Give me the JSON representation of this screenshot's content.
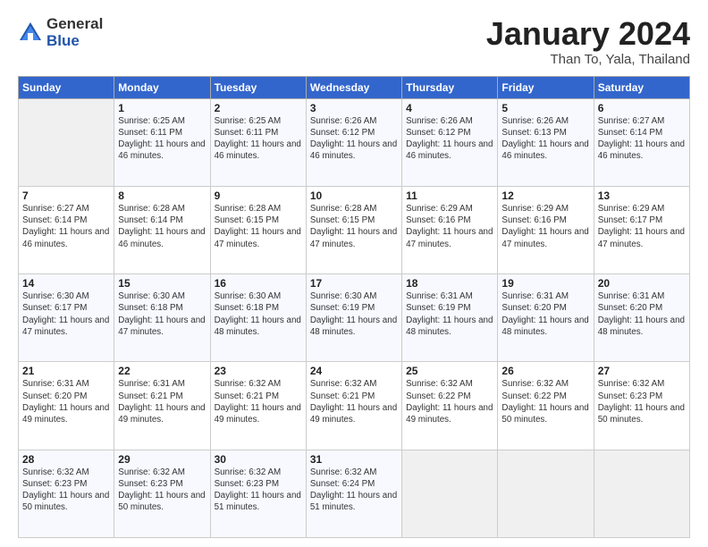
{
  "header": {
    "logo": {
      "general": "General",
      "blue": "Blue"
    },
    "title": "January 2024",
    "location": "Than To, Yala, Thailand"
  },
  "calendar": {
    "days_of_week": [
      "Sunday",
      "Monday",
      "Tuesday",
      "Wednesday",
      "Thursday",
      "Friday",
      "Saturday"
    ],
    "weeks": [
      [
        {
          "day": "",
          "empty": true
        },
        {
          "day": "1",
          "sunrise": "6:25 AM",
          "sunset": "6:11 PM",
          "daylight": "11 hours and 46 minutes."
        },
        {
          "day": "2",
          "sunrise": "6:25 AM",
          "sunset": "6:11 PM",
          "daylight": "11 hours and 46 minutes."
        },
        {
          "day": "3",
          "sunrise": "6:26 AM",
          "sunset": "6:12 PM",
          "daylight": "11 hours and 46 minutes."
        },
        {
          "day": "4",
          "sunrise": "6:26 AM",
          "sunset": "6:12 PM",
          "daylight": "11 hours and 46 minutes."
        },
        {
          "day": "5",
          "sunrise": "6:26 AM",
          "sunset": "6:13 PM",
          "daylight": "11 hours and 46 minutes."
        },
        {
          "day": "6",
          "sunrise": "6:27 AM",
          "sunset": "6:14 PM",
          "daylight": "11 hours and 46 minutes."
        }
      ],
      [
        {
          "day": "7",
          "sunrise": "6:27 AM",
          "sunset": "6:14 PM",
          "daylight": "11 hours and 46 minutes."
        },
        {
          "day": "8",
          "sunrise": "6:28 AM",
          "sunset": "6:14 PM",
          "daylight": "11 hours and 46 minutes."
        },
        {
          "day": "9",
          "sunrise": "6:28 AM",
          "sunset": "6:15 PM",
          "daylight": "11 hours and 47 minutes."
        },
        {
          "day": "10",
          "sunrise": "6:28 AM",
          "sunset": "6:15 PM",
          "daylight": "11 hours and 47 minutes."
        },
        {
          "day": "11",
          "sunrise": "6:29 AM",
          "sunset": "6:16 PM",
          "daylight": "11 hours and 47 minutes."
        },
        {
          "day": "12",
          "sunrise": "6:29 AM",
          "sunset": "6:16 PM",
          "daylight": "11 hours and 47 minutes."
        },
        {
          "day": "13",
          "sunrise": "6:29 AM",
          "sunset": "6:17 PM",
          "daylight": "11 hours and 47 minutes."
        }
      ],
      [
        {
          "day": "14",
          "sunrise": "6:30 AM",
          "sunset": "6:17 PM",
          "daylight": "11 hours and 47 minutes."
        },
        {
          "day": "15",
          "sunrise": "6:30 AM",
          "sunset": "6:18 PM",
          "daylight": "11 hours and 47 minutes."
        },
        {
          "day": "16",
          "sunrise": "6:30 AM",
          "sunset": "6:18 PM",
          "daylight": "11 hours and 48 minutes."
        },
        {
          "day": "17",
          "sunrise": "6:30 AM",
          "sunset": "6:19 PM",
          "daylight": "11 hours and 48 minutes."
        },
        {
          "day": "18",
          "sunrise": "6:31 AM",
          "sunset": "6:19 PM",
          "daylight": "11 hours and 48 minutes."
        },
        {
          "day": "19",
          "sunrise": "6:31 AM",
          "sunset": "6:20 PM",
          "daylight": "11 hours and 48 minutes."
        },
        {
          "day": "20",
          "sunrise": "6:31 AM",
          "sunset": "6:20 PM",
          "daylight": "11 hours and 48 minutes."
        }
      ],
      [
        {
          "day": "21",
          "sunrise": "6:31 AM",
          "sunset": "6:20 PM",
          "daylight": "11 hours and 49 minutes."
        },
        {
          "day": "22",
          "sunrise": "6:31 AM",
          "sunset": "6:21 PM",
          "daylight": "11 hours and 49 minutes."
        },
        {
          "day": "23",
          "sunrise": "6:32 AM",
          "sunset": "6:21 PM",
          "daylight": "11 hours and 49 minutes."
        },
        {
          "day": "24",
          "sunrise": "6:32 AM",
          "sunset": "6:21 PM",
          "daylight": "11 hours and 49 minutes."
        },
        {
          "day": "25",
          "sunrise": "6:32 AM",
          "sunset": "6:22 PM",
          "daylight": "11 hours and 49 minutes."
        },
        {
          "day": "26",
          "sunrise": "6:32 AM",
          "sunset": "6:22 PM",
          "daylight": "11 hours and 50 minutes."
        },
        {
          "day": "27",
          "sunrise": "6:32 AM",
          "sunset": "6:23 PM",
          "daylight": "11 hours and 50 minutes."
        }
      ],
      [
        {
          "day": "28",
          "sunrise": "6:32 AM",
          "sunset": "6:23 PM",
          "daylight": "11 hours and 50 minutes."
        },
        {
          "day": "29",
          "sunrise": "6:32 AM",
          "sunset": "6:23 PM",
          "daylight": "11 hours and 50 minutes."
        },
        {
          "day": "30",
          "sunrise": "6:32 AM",
          "sunset": "6:23 PM",
          "daylight": "11 hours and 51 minutes."
        },
        {
          "day": "31",
          "sunrise": "6:32 AM",
          "sunset": "6:24 PM",
          "daylight": "11 hours and 51 minutes."
        },
        {
          "day": "",
          "empty": true
        },
        {
          "day": "",
          "empty": true
        },
        {
          "day": "",
          "empty": true
        }
      ]
    ]
  },
  "labels": {
    "sunrise": "Sunrise:",
    "sunset": "Sunset:",
    "daylight": "Daylight:"
  }
}
